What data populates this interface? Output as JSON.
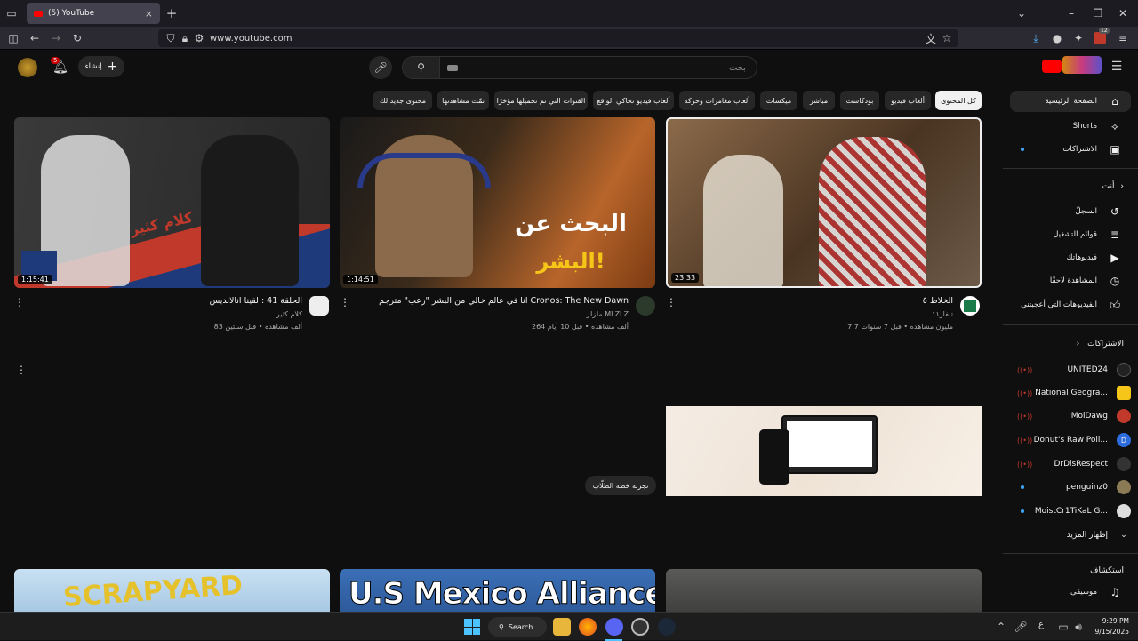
{
  "browser": {
    "tab_title": "(5) YouTube",
    "url": "www.youtube.com",
    "extension_badge": "12"
  },
  "header": {
    "create_label": "إنشاء",
    "notification_count": "5",
    "search_placeholder": "بحث"
  },
  "chips": [
    {
      "label": "كل المحتوى",
      "active": true
    },
    {
      "label": "ألعاب فيديو"
    },
    {
      "label": "بودكاست"
    },
    {
      "label": "مباشر"
    },
    {
      "label": "ميكسات"
    },
    {
      "label": "ألعاب مغامرات وحركة"
    },
    {
      "label": "ألعاب فيديو تحاكي الواقع"
    },
    {
      "label": "القنوات التي تم تحميلها مؤخرًا"
    },
    {
      "label": "تمّت مشاهدتها"
    },
    {
      "label": "محتوى جديد لك"
    }
  ],
  "videos": [
    {
      "title": "الخلاط ٥",
      "channel": "تلفاز١١",
      "meta": "7.7 مليون مشاهدة • قبل 7 سنوات",
      "duration": "23:33"
    },
    {
      "title": "انا في عالم خالي من البشر \"رعب\" مترجم Cronos: The New Dawn",
      "channel": "ملزلز MLZLZ",
      "meta": "264 ألف مشاهدة • قبل 10 أيام",
      "duration": "1:14:51"
    },
    {
      "title": "الحلقة 41 : لقينا انالانديس",
      "channel": "كلام كثير",
      "meta": "83 ألف مشاهدة • قبل سنتين",
      "duration": "1:15:41"
    }
  ],
  "thumb_text": {
    "v2_line1": "البحث عن",
    "v2_line2": "البشر!",
    "v3_logo": "كلام كثير",
    "row2_b": "U.S Mexico Alliance",
    "row2_c": "SCRAPYARD"
  },
  "promo": {
    "button": "تجربة خطة الطلّاب"
  },
  "sidebar": {
    "main": [
      {
        "label": "الصفحة الرئيسية",
        "icon": "home-icon"
      },
      {
        "label": "Shorts",
        "icon": "shorts-icon"
      },
      {
        "label": "الاشتراكات",
        "icon": "subscriptions-icon"
      }
    ],
    "you_header": "أنت",
    "you": [
      {
        "label": "السجلّ",
        "icon": "history-icon"
      },
      {
        "label": "قوائم التشغيل",
        "icon": "playlist-icon"
      },
      {
        "label": "فيديوهاتك",
        "icon": "your-videos-icon"
      },
      {
        "label": "المشاهدة لاحقًا",
        "icon": "watch-later-icon"
      },
      {
        "label": "الفيديوهات التي أعجبتني",
        "icon": "like-icon"
      }
    ],
    "subs_header": "الاشتراكات",
    "subscriptions": [
      {
        "name": "UNITED24",
        "live": true,
        "color": "#222"
      },
      {
        "name": "National Geogra...",
        "live": true,
        "color": "#f5c518"
      },
      {
        "name": "MoiDawg",
        "live": true,
        "color": "#c0392b"
      },
      {
        "name": "Donut's Raw Poli...",
        "live": true,
        "color": "#2d6cdf"
      },
      {
        "name": "DrDisRespect",
        "live": true,
        "color": "#333"
      },
      {
        "name": "penguinz0",
        "new": true,
        "color": "#8a7a55"
      },
      {
        "name": "MoistCr1TiKaL G...",
        "new": true,
        "color": "#ddd"
      }
    ],
    "show_more": "إظهار المزيد",
    "explore_header": "استكشاف",
    "explore": [
      {
        "label": "موسيقى",
        "icon": "music-icon"
      }
    ]
  },
  "taskbar": {
    "search": "Search",
    "time": "9:29 PM",
    "date": "9/15/2025",
    "lang": "ع"
  }
}
